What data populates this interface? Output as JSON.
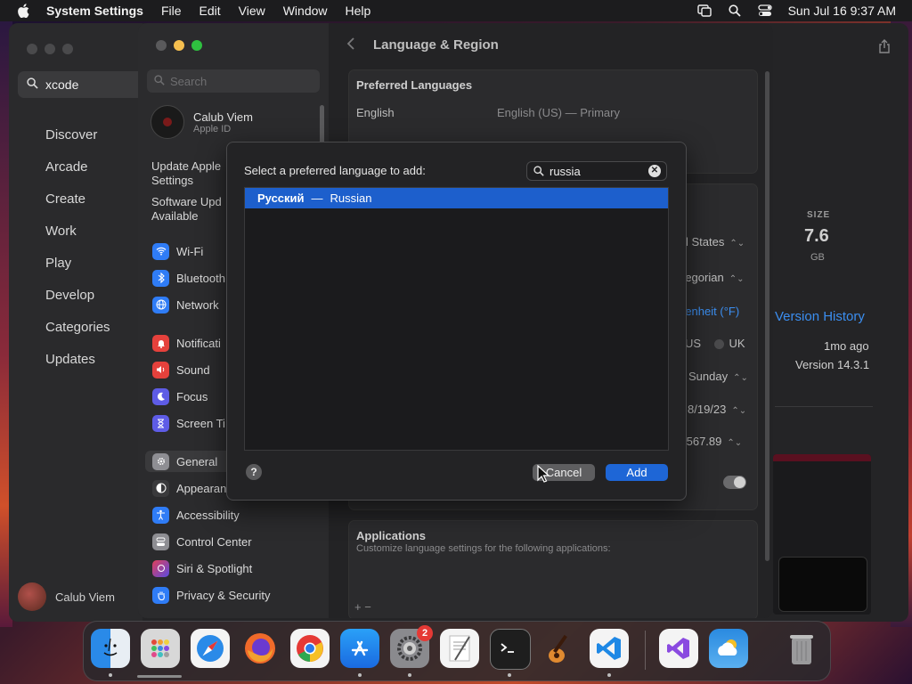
{
  "menubar": {
    "app_name": "System Settings",
    "menus": [
      "File",
      "Edit",
      "View",
      "Window",
      "Help"
    ],
    "datetime": "Sun Jul 16  9:37 AM"
  },
  "appstore": {
    "search_value": "xcode",
    "nav": [
      "Discover",
      "Arcade",
      "Create",
      "Work",
      "Play",
      "Develop",
      "Categories",
      "Updates"
    ],
    "user_name": "Calub Viem",
    "size_label": "SIZE",
    "size_value": "7.6",
    "size_unit": "GB",
    "version_history": "Version History",
    "updated_ago": "1mo ago",
    "version": "Version 14.3.1"
  },
  "settings": {
    "search_placeholder": "Search",
    "user_name": "Calub Viem",
    "user_sub": "Apple ID",
    "update_line1": "Update Apple",
    "update_line2": "Settings",
    "sw_update_line1": "Software Upd",
    "sw_update_line2": "Available",
    "sidebar_items": [
      {
        "label": "Wi-Fi",
        "color": "#2f7cf6"
      },
      {
        "label": "Bluetooth",
        "color": "#2f7cf6"
      },
      {
        "label": "Network",
        "color": "#2f7cf6"
      },
      {
        "label": "Notificati",
        "color": "#e5413c"
      },
      {
        "label": "Sound",
        "color": "#e5413c"
      },
      {
        "label": "Focus",
        "color": "#5e5ce6"
      },
      {
        "label": "Screen Ti",
        "color": "#5e5ce6"
      },
      {
        "label": "General",
        "color": "#8e8e93"
      },
      {
        "label": "Appearan",
        "color": "#3a3a3c"
      },
      {
        "label": "Accessibility",
        "color": "#2f7cf6"
      },
      {
        "label": "Control Center",
        "color": "#8e8e93"
      },
      {
        "label": "Siri & Spotlight",
        "color": "#b24cd6"
      },
      {
        "label": "Privacy & Security",
        "color": "#2f7cf6"
      }
    ],
    "title": "Language & Region",
    "preferred_languages": "Preferred Languages",
    "lang_name": "English",
    "lang_detail": "English (US) — Primary",
    "region_val": "l States",
    "calendar_val": "regorian",
    "temp_val": "renheit (°F)",
    "measure_us": "US",
    "measure_uk": "UK",
    "first_day_val": "Sunday",
    "date_val": "8/19/23",
    "number_val": ",567.89",
    "applications_title": "Applications",
    "applications_desc": "Customize language settings for the following applications:",
    "add_remove": "+   −"
  },
  "sheet": {
    "prompt": "Select a preferred language to add:",
    "search_value": "russia",
    "results": [
      {
        "native": "Русский",
        "english": "Russian"
      }
    ],
    "dash": "—",
    "help": "?",
    "cancel_label": "Cancel",
    "add_label": "Add"
  },
  "dock": {
    "apps": [
      {
        "name": "Finder",
        "color": "#3aa0f0"
      },
      {
        "name": "Launchpad",
        "color": "#d8d8d8"
      },
      {
        "name": "Safari",
        "color": "#f4f4f4"
      },
      {
        "name": "Firefox",
        "color": "#f06a2a"
      },
      {
        "name": "Chrome",
        "color": "#f4f4f4"
      },
      {
        "name": "App Store",
        "color": "#1e8cf0"
      },
      {
        "name": "System Settings",
        "color": "#8a8a8e"
      },
      {
        "name": "TextEdit",
        "color": "#f4f4f4"
      },
      {
        "name": "Terminal",
        "color": "#1e1e1e"
      },
      {
        "name": "GarageBand",
        "color": "#7a4a20"
      },
      {
        "name": "Visual Studio Code",
        "color": "#f4f4f4"
      },
      {
        "name": "Visual Studio",
        "color": "#f4f4f4"
      },
      {
        "name": "Weather",
        "color": "#3a8ae0"
      },
      {
        "name": "Trash",
        "color": "#6a6a6c"
      }
    ],
    "settings_badge": "2"
  }
}
